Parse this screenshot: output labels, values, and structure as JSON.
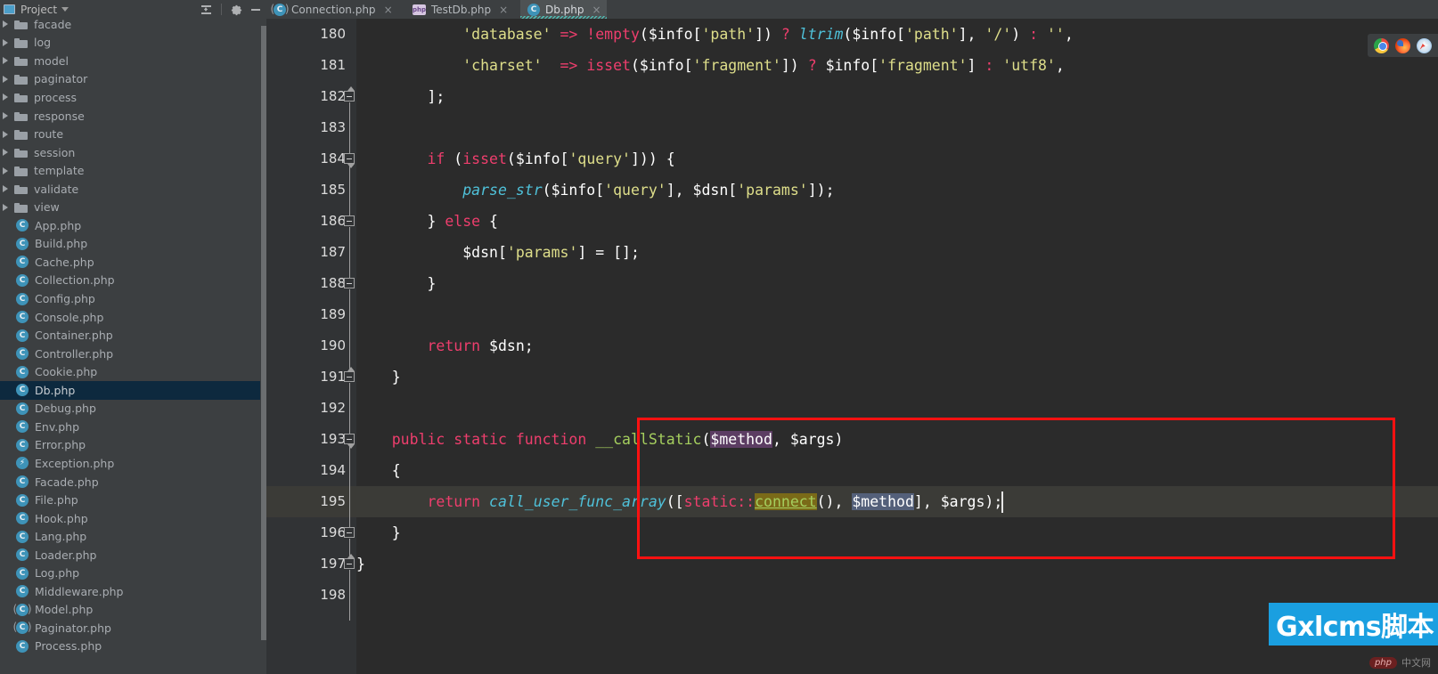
{
  "project_panel": {
    "title": "Project",
    "window_icon": "project-window-icon",
    "caret_icon": "chevron-down-icon",
    "tools": [
      {
        "name": "collapse-all-icon",
        "label": "Collapse All"
      },
      {
        "name": "gear-icon",
        "label": "Settings"
      },
      {
        "name": "minimize-icon",
        "label": "Hide"
      }
    ],
    "folders": [
      "facade",
      "log",
      "model",
      "paginator",
      "process",
      "response",
      "route",
      "session",
      "template",
      "validate",
      "view"
    ],
    "files": [
      {
        "name": "App.php",
        "icon": "class-icon"
      },
      {
        "name": "Build.php",
        "icon": "class-icon"
      },
      {
        "name": "Cache.php",
        "icon": "class-icon"
      },
      {
        "name": "Collection.php",
        "icon": "class-icon"
      },
      {
        "name": "Config.php",
        "icon": "class-icon"
      },
      {
        "name": "Console.php",
        "icon": "class-icon"
      },
      {
        "name": "Container.php",
        "icon": "class-icon"
      },
      {
        "name": "Controller.php",
        "icon": "class-icon"
      },
      {
        "name": "Cookie.php",
        "icon": "class-icon"
      },
      {
        "name": "Db.php",
        "icon": "class-icon",
        "selected": true
      },
      {
        "name": "Debug.php",
        "icon": "class-icon"
      },
      {
        "name": "Env.php",
        "icon": "class-icon"
      },
      {
        "name": "Error.php",
        "icon": "class-icon"
      },
      {
        "name": "Exception.php",
        "icon": "exception-class-icon"
      },
      {
        "name": "Facade.php",
        "icon": "class-icon"
      },
      {
        "name": "File.php",
        "icon": "class-icon"
      },
      {
        "name": "Hook.php",
        "icon": "class-icon"
      },
      {
        "name": "Lang.php",
        "icon": "class-icon"
      },
      {
        "name": "Loader.php",
        "icon": "class-icon"
      },
      {
        "name": "Log.php",
        "icon": "class-icon"
      },
      {
        "name": "Middleware.php",
        "icon": "class-icon"
      },
      {
        "name": "Model.php",
        "icon": "abstract-class-icon"
      },
      {
        "name": "Paginator.php",
        "icon": "abstract-class-icon"
      },
      {
        "name": "Process.php",
        "icon": "class-icon"
      }
    ]
  },
  "tabs": [
    {
      "label": "Connection.php",
      "icon": "abstract-class-icon",
      "active": false,
      "close": "×"
    },
    {
      "label": "TestDb.php",
      "icon": "php-file-icon",
      "active": false,
      "close": "×"
    },
    {
      "label": "Db.php",
      "icon": "class-icon",
      "active": true,
      "close": "×"
    }
  ],
  "editor": {
    "first_line": 180,
    "caret_line": 195,
    "lines": [
      {
        "n": 180,
        "indent": 0,
        "html": "<span class=\"str\">            'database'</span><span class=\"pun\"> </span><span class=\"kw\">=&gt;</span><span class=\"pun\"> </span><span class=\"kw\">!</span><span class=\"kw\">empty</span><span class=\"pun\">(</span><span class=\"var\">$info</span><span class=\"pun\">[</span><span class=\"str\">'path'</span><span class=\"pun\">])</span><span class=\"pun\"> </span><span class=\"kw\">?</span><span class=\"pun\"> </span><span class=\"fn\">ltrim</span><span class=\"pun\">(</span><span class=\"var\">$info</span><span class=\"pun\">[</span><span class=\"str\">'path'</span><span class=\"pun\">], </span><span class=\"str\">'/'</span><span class=\"pun\">)</span><span class=\"pun\"> </span><span class=\"kw\">:</span><span class=\"pun\"> </span><span class=\"str\">''</span><span class=\"pun\">,</span>"
      },
      {
        "n": 181,
        "indent": 0,
        "html": "<span class=\"str\">            'charset'</span><span class=\"pun\">  </span><span class=\"kw\">=&gt;</span><span class=\"pun\"> </span><span class=\"kw\">isset</span><span class=\"pun\">(</span><span class=\"var\">$info</span><span class=\"pun\">[</span><span class=\"str\">'fragment'</span><span class=\"pun\">])</span><span class=\"pun\"> </span><span class=\"kw\">?</span><span class=\"pun\"> </span><span class=\"var\">$info</span><span class=\"pun\">[</span><span class=\"str\">'fragment'</span><span class=\"pun\">]</span><span class=\"pun\"> </span><span class=\"kw\">:</span><span class=\"pun\"> </span><span class=\"str\">'utf8'</span><span class=\"pun\">,</span>"
      },
      {
        "n": 182,
        "indent": 0,
        "html": "<span class=\"pun\">        ];</span>"
      },
      {
        "n": 183,
        "indent": 0,
        "html": ""
      },
      {
        "n": 184,
        "indent": 0,
        "html": "<span class=\"pun\">        </span><span class=\"kw\">if</span><span class=\"pun\"> (</span><span class=\"kw\">isset</span><span class=\"pun\">(</span><span class=\"var\">$info</span><span class=\"pun\">[</span><span class=\"str\">'query'</span><span class=\"pun\">])) {</span>"
      },
      {
        "n": 185,
        "indent": 0,
        "html": "<span class=\"pun\">            </span><span class=\"fn\">parse_str</span><span class=\"pun\">(</span><span class=\"var\">$info</span><span class=\"pun\">[</span><span class=\"str\">'query'</span><span class=\"pun\">], </span><span class=\"var\">$dsn</span><span class=\"pun\">[</span><span class=\"str\">'params'</span><span class=\"pun\">]);</span>"
      },
      {
        "n": 186,
        "indent": 0,
        "html": "<span class=\"pun\">        } </span><span class=\"kw\">else</span><span class=\"pun\"> {</span>"
      },
      {
        "n": 187,
        "indent": 0,
        "html": "<span class=\"pun\">            </span><span class=\"var\">$dsn</span><span class=\"pun\">[</span><span class=\"str\">'params'</span><span class=\"pun\">] = [];</span>"
      },
      {
        "n": 188,
        "indent": 0,
        "html": "<span class=\"pun\">        }</span>"
      },
      {
        "n": 189,
        "indent": 0,
        "html": ""
      },
      {
        "n": 190,
        "indent": 0,
        "html": "<span class=\"pun\">        </span><span class=\"kw\">return</span><span class=\"pun\"> </span><span class=\"var\">$dsn</span><span class=\"pun\">;</span>"
      },
      {
        "n": 191,
        "indent": 0,
        "html": "<span class=\"pun\">    }</span>"
      },
      {
        "n": 192,
        "indent": 0,
        "html": ""
      },
      {
        "n": 193,
        "indent": 0,
        "html": "<span class=\"pun\">    </span><span class=\"kw\">public static function</span><span class=\"pun\"> </span><span class=\"meth\">__callStatic</span><span class=\"pun\">(</span><span class=\"hl-purple var\">$method</span><span class=\"pun\">, </span><span class=\"var\">$args</span><span class=\"pun\">)</span>"
      },
      {
        "n": 194,
        "indent": 0,
        "html": "<span class=\"pun\">    {</span>"
      },
      {
        "n": 195,
        "indent": 0,
        "caret": true,
        "html": "<span class=\"pun\">        </span><span class=\"kw\">return</span><span class=\"pun\"> </span><span class=\"fn\">call_user_func_array</span><span class=\"pun\">([</span><span class=\"kw\">static</span><span class=\"kw\">::</span><span class=\"hl-olive meth\">connect</span><span class=\"pun\">(), </span><span class=\"hl-blue var\">$method</span><span class=\"pun\">], </span><span class=\"var\">$args</span><span class=\"pun\">);</span>"
      },
      {
        "n": 196,
        "indent": 0,
        "html": "<span class=\"pun\">    }</span>"
      },
      {
        "n": 197,
        "indent": 0,
        "html": "<span class=\"pun\">}</span>"
      },
      {
        "n": 198,
        "indent": 0,
        "html": ""
      }
    ],
    "code_text": {
      "180": "            'database' => !empty($info['path']) ? ltrim($info['path'], '/') : '',",
      "181": "            'charset'  => isset($info['fragment']) ? $info['fragment'] : 'utf8',",
      "182": "        ];",
      "183": "",
      "184": "        if (isset($info['query'])) {",
      "185": "            parse_str($info['query'], $dsn['params']);",
      "186": "        } else {",
      "187": "            $dsn['params'] = [];",
      "188": "        }",
      "189": "",
      "190": "        return $dsn;",
      "191": "    }",
      "192": "",
      "193": "    public static function __callStatic($method, $args)",
      "194": "    {",
      "195": "        return call_user_func_array([static::connect(), $method], $args);",
      "196": "    }",
      "197": "}",
      "198": ""
    }
  },
  "annotation": {
    "name": "red-highlight-rectangle",
    "color": "#ff1111"
  },
  "browser_strip": [
    {
      "name": "chrome-icon",
      "label": "Chrome"
    },
    {
      "name": "firefox-icon",
      "label": "Firefox"
    },
    {
      "name": "safari-icon",
      "label": "Safari"
    }
  ],
  "watermark": {
    "banner_text": "Gxlcms脚本",
    "banner_color": "#1a9fe0",
    "badge_text": "php",
    "badge_sub": "中文网"
  }
}
